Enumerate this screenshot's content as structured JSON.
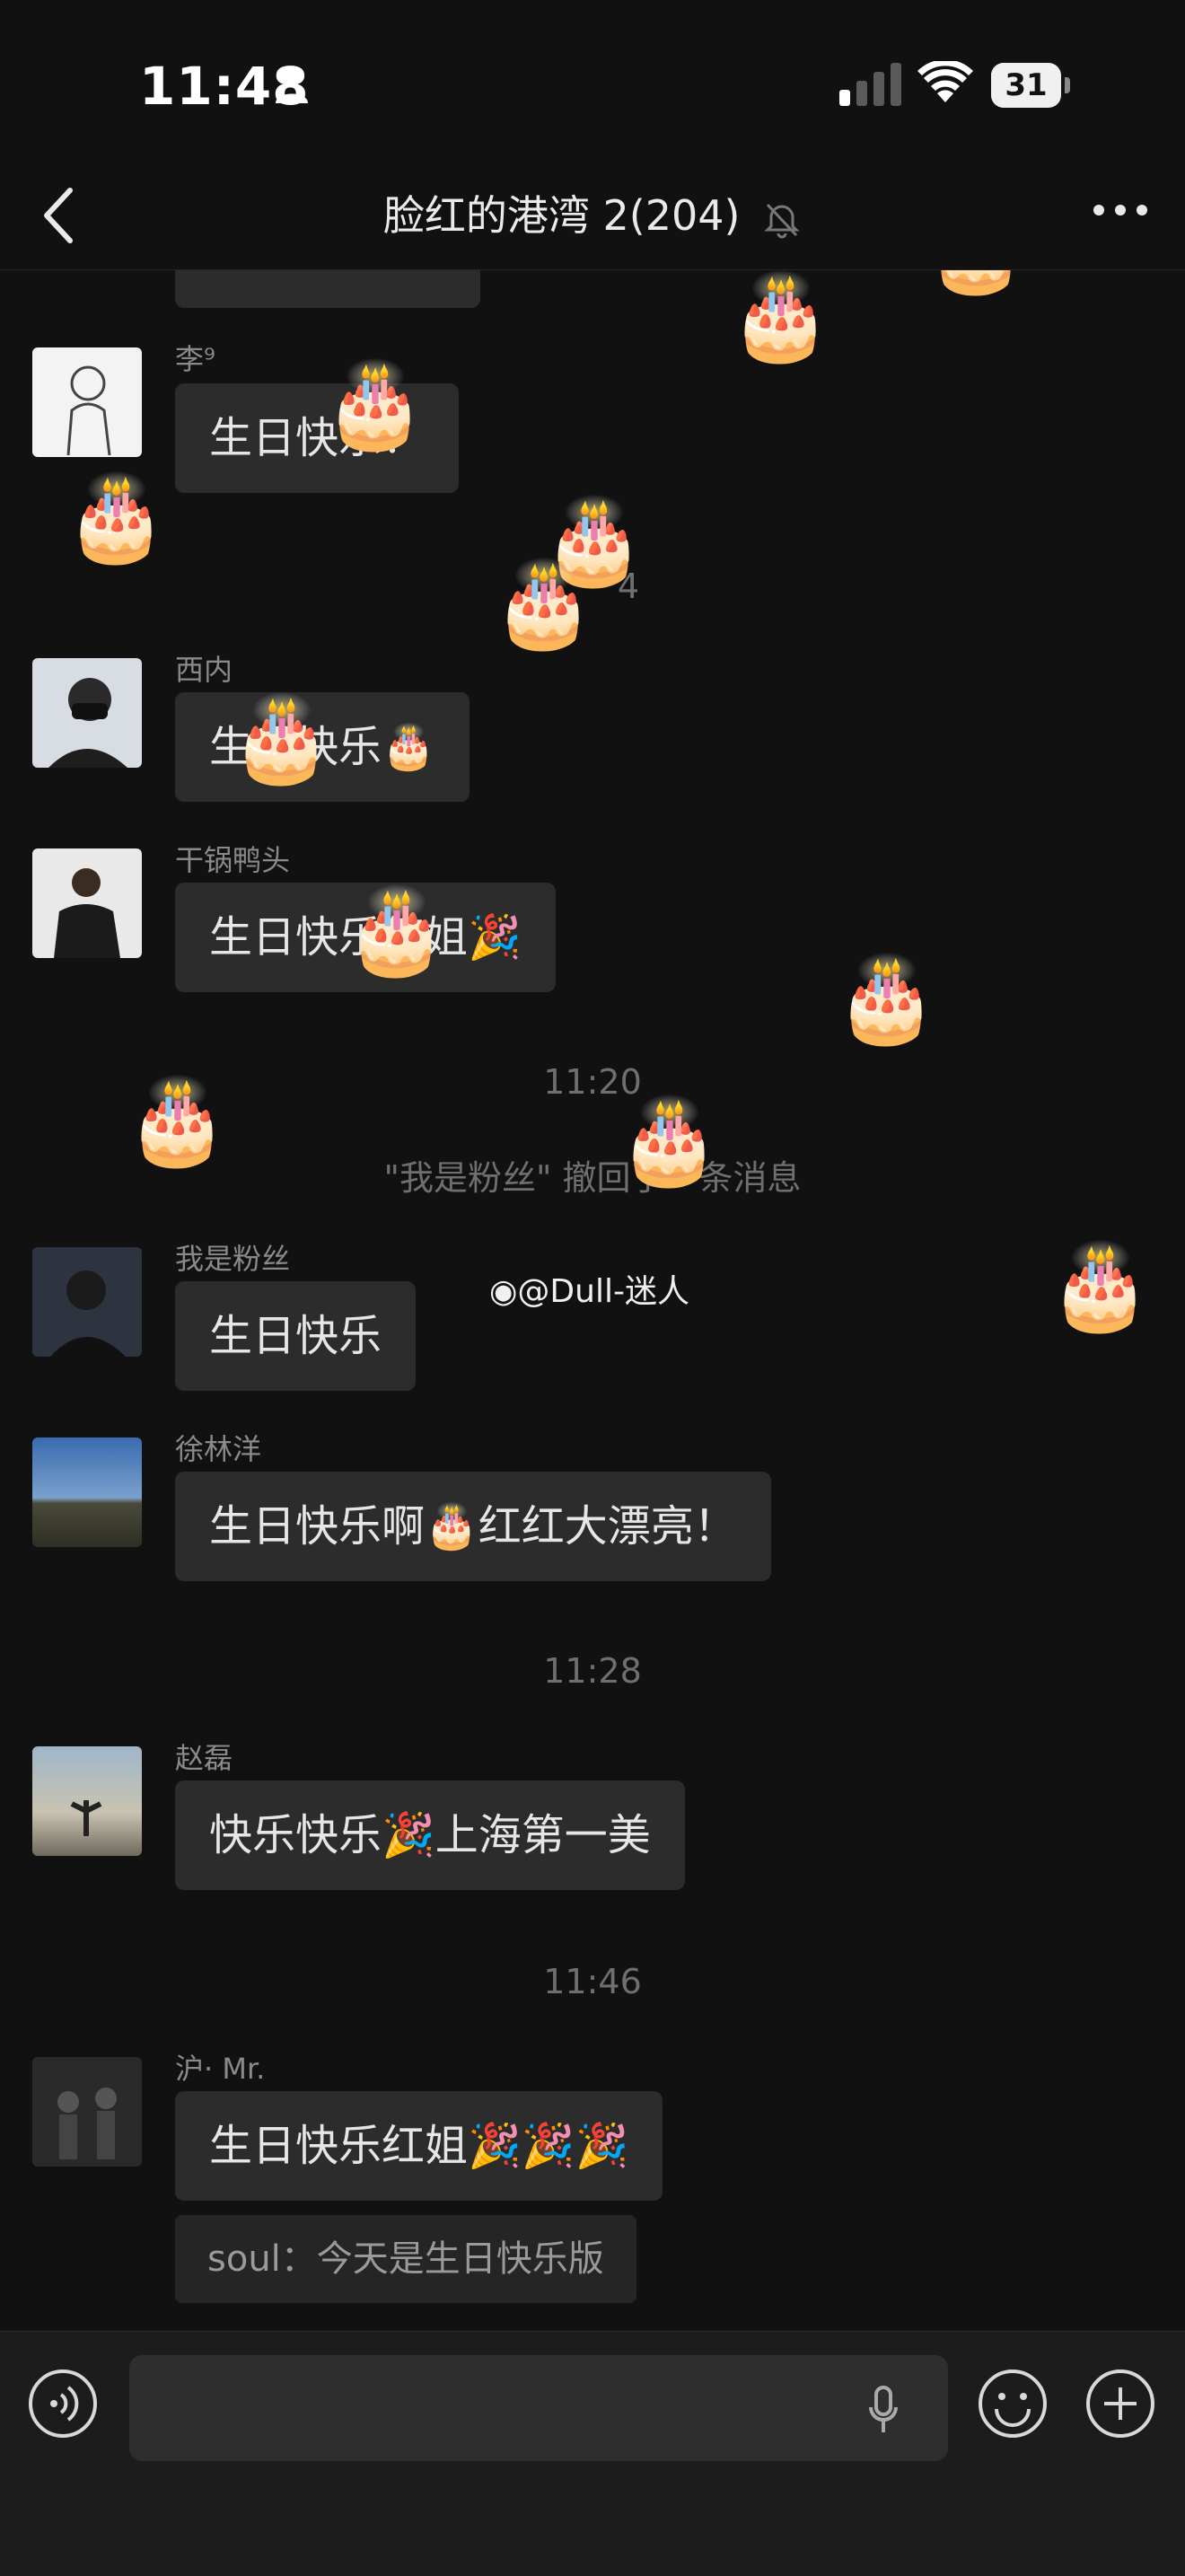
{
  "status_bar": {
    "time": "11:48",
    "battery": "31",
    "battery_level": 0.31
  },
  "nav": {
    "title": "脸红的港湾 2(204)"
  },
  "messages": [
    {
      "sender": "李⁹",
      "text": "生日快乐！"
    },
    {
      "sender": "西内",
      "text": "生日快乐🎂"
    },
    {
      "sender": "干锅鸭头",
      "text": "生日快乐红姐🎉"
    },
    {
      "sender": "我是粉丝",
      "text": "生日快乐"
    },
    {
      "sender": "徐林洋",
      "text": "生日快乐啊🎂红红大漂亮！"
    },
    {
      "sender": "赵磊",
      "text": "快乐快乐🎉上海第一美"
    },
    {
      "sender": "沪· Mr.",
      "text": "生日快乐红姐🎉🎉🎉",
      "quote": "soul：今天是生日快乐版"
    }
  ],
  "timestamps": [
    "11:20",
    "11:28",
    "11:46"
  ],
  "partial_text": "4",
  "system_message": "\"我是粉丝\" 撤回了一条消息",
  "watermark": "@Dull-迷人",
  "cake_emoji": "🎂",
  "icons": [
    "person-icon",
    "signal-icon",
    "wifi-icon",
    "back-icon",
    "mute-icon",
    "more-icon",
    "voice-icon",
    "mic-icon",
    "emoji-icon",
    "plus-icon"
  ]
}
